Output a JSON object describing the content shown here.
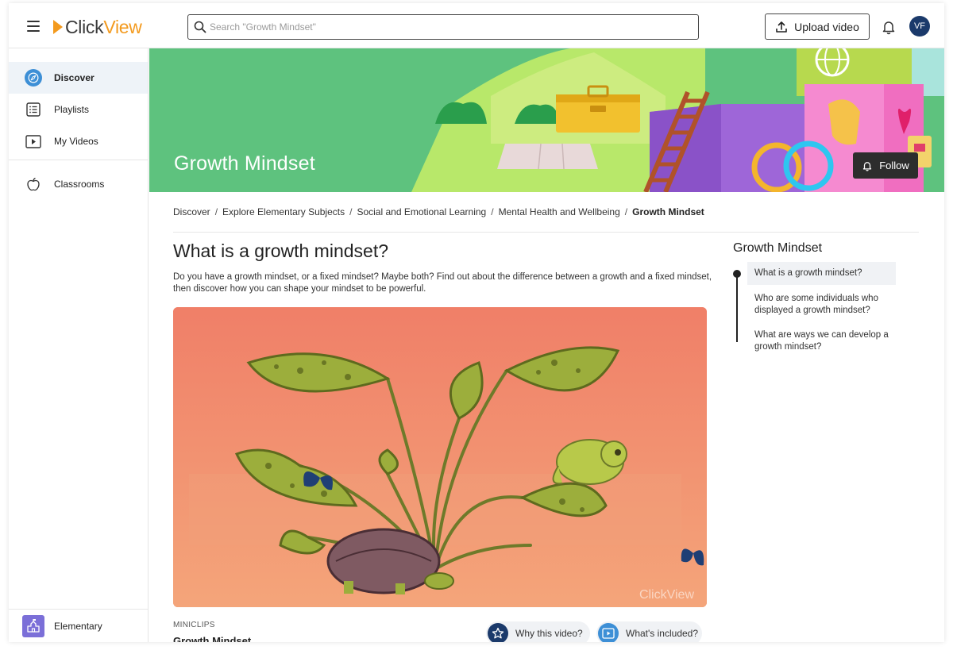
{
  "app": {
    "logo_click": "Click",
    "logo_view": "View"
  },
  "search": {
    "placeholder": "Search \"Growth Mindset\""
  },
  "header": {
    "upload_label": "Upload video",
    "avatar_initials": "VF"
  },
  "sidebar": {
    "items": [
      {
        "label": "Discover",
        "icon": "compass-icon"
      },
      {
        "label": "Playlists",
        "icon": "list-icon"
      },
      {
        "label": "My Videos",
        "icon": "play-icon"
      },
      {
        "label": "Classrooms",
        "icon": "apple-icon"
      }
    ],
    "bottom": {
      "label": "Elementary",
      "icon": "school-icon"
    }
  },
  "banner": {
    "title": "Growth Mindset",
    "follow_label": "Follow"
  },
  "breadcrumb": [
    "Discover",
    "Explore Elementary Subjects",
    "Social and Emotional Learning",
    "Mental Health and Wellbeing",
    "Growth Mindset"
  ],
  "main": {
    "title": "What is a growth mindset?",
    "description": "Do you have a growth mindset, or a fixed mindset? Maybe both? Find out about the difference between a growth and a fixed mindset, then discover how you can shape your mindset to be powerful.",
    "video_watermark": "ClickView",
    "category": "MINICLIPS",
    "video_title": "Growth Mindset",
    "why_label": "Why this video?",
    "included_label": "What's included?"
  },
  "toc": {
    "title": "Growth Mindset",
    "items": [
      "What is a growth mindset?",
      "Who are some individuals who displayed a growth mindset?",
      "What are ways we can develop a growth mindset?"
    ]
  },
  "colors": {
    "accent": "#f39a1e",
    "avatar": "#1b3a6b",
    "discover_icon": "#3d8fd6",
    "banner_green": "#5ec27e",
    "video_bg": "#f08468"
  }
}
